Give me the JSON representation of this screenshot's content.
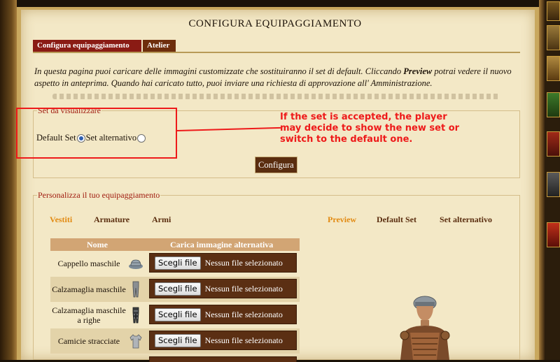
{
  "page": {
    "title": "CONFIGURA EQUIPAGGIAMENTO"
  },
  "tabs": {
    "configure": "Configura equipaggiamento",
    "atelier": "Atelier"
  },
  "intro": {
    "part1": "In questa pagina puoi caricare delle immagini customizzate che sostituiranno il set di default. Cliccando ",
    "preview_word": "Preview",
    "part2": " potrai vedere il nuovo aspetto in anteprima. Quando hai caricato tutto, puoi inviare una richiesta di approvazione all' Amministrazione."
  },
  "set_section": {
    "legend": "Set da visualizzare",
    "default_label": "Default Set",
    "alt_label": "Set alternativo",
    "selected": "default",
    "configure_button": "Configura"
  },
  "annotation": {
    "line1": "If the set is accepted, the player",
    "line2": "may decide to show the new set or",
    "line3": "switch to the default one.",
    "color": "#ee1a1a"
  },
  "custom_section": {
    "legend": "Personalizza il tuo equipaggiamento",
    "subtabs": {
      "clothes": "Vestiti",
      "armor": "Armature",
      "weapons": "Armi",
      "preview": "Preview",
      "default_set": "Default Set",
      "alt_set": "Set alternativo"
    },
    "active_subtab": "Vestiti",
    "table": {
      "col_name": "Nome",
      "col_upload": "Carica immagine alternativa",
      "rows": [
        {
          "name": "Cappello maschile",
          "icon": "hat-icon",
          "button": "Scegli file",
          "status": "Nessun file selezionato"
        },
        {
          "name": "Calzamaglia maschile",
          "icon": "tights-icon",
          "button": "Scegli file",
          "status": "Nessun file selezionato"
        },
        {
          "name": "Calzamaglia maschile a righe",
          "icon": "striped-tights-icon",
          "button": "Scegli file",
          "status": "Nessun file selezionato"
        },
        {
          "name": "Camicie stracciate",
          "icon": "shirt-icon",
          "button": "Scegli file",
          "status": "Nessun file selezionato"
        }
      ]
    }
  },
  "colors": {
    "parchment": "#f3e8c6",
    "tab_active": "#8a1b14",
    "tab_inactive": "#6e2e0c",
    "legend_text": "#a01c10",
    "subtab_active": "#e28a12",
    "table_header": "#d2a574",
    "file_box": "#5b2f13"
  }
}
